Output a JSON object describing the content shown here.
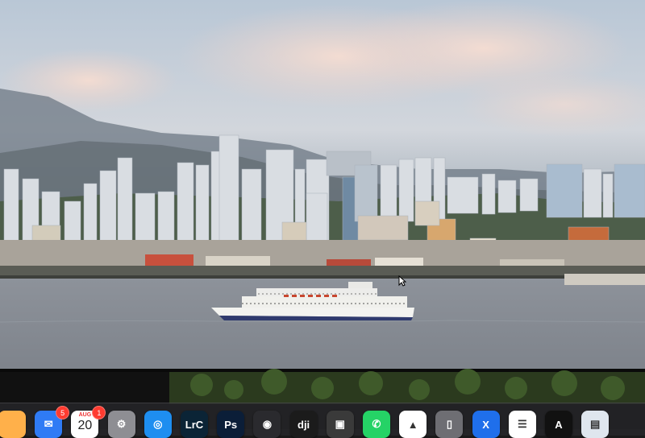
{
  "dock": {
    "items": [
      {
        "name": "launchpad",
        "label": "",
        "color": "#ffb04a"
      },
      {
        "name": "mail",
        "label": "✉",
        "color": "#2f7bf5"
      },
      {
        "name": "calendar",
        "label": "",
        "color": "#ffffff"
      },
      {
        "name": "system-settings",
        "label": "⚙",
        "color": "#8e8e93"
      },
      {
        "name": "safari",
        "label": "◎",
        "color": "#1e8ef0"
      },
      {
        "name": "lightroom-classic",
        "label": "LrC",
        "color": "#0b2436"
      },
      {
        "name": "photoshop",
        "label": "Ps",
        "color": "#0b1e38"
      },
      {
        "name": "davinci-resolve",
        "label": "◉",
        "color": "#2a2a2e"
      },
      {
        "name": "dji",
        "label": "dji",
        "color": "#1b1b1b"
      },
      {
        "name": "photo-booth",
        "label": "▣",
        "color": "#3a3a3a"
      },
      {
        "name": "whatsapp",
        "label": "✆",
        "color": "#25d366"
      },
      {
        "name": "google-drive",
        "label": "▲",
        "color": "#ffffff"
      },
      {
        "name": "iphone-mirroring",
        "label": "▯",
        "color": "#6e6e73"
      },
      {
        "name": "x",
        "label": "X",
        "color": "#1f6feb"
      },
      {
        "name": "reminders",
        "label": "☰",
        "color": "#ffffff"
      },
      {
        "name": "instruments",
        "label": "A",
        "color": "#111111"
      },
      {
        "name": "preview",
        "label": "▤",
        "color": "#dfe6ee"
      }
    ],
    "badges": {
      "mail": "5",
      "calendar": "1"
    },
    "calendar": {
      "month": "AUG",
      "day": "20"
    }
  }
}
